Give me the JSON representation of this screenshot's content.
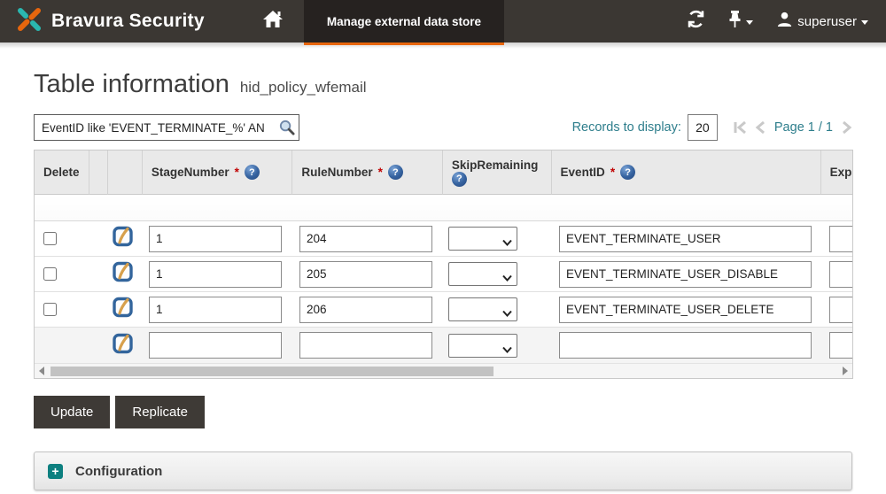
{
  "navbar": {
    "brand": "Bravura Security",
    "active_tab": "Manage external data store",
    "username": "superuser"
  },
  "page": {
    "title": "Table information",
    "subtitle": "hid_policy_wfemail"
  },
  "toolbar": {
    "search_value": "EventID like 'EVENT_TERMINATE_%' AN",
    "records_label": "Records to display:",
    "records_value": "20",
    "page_indicator": "Page 1 / 1"
  },
  "table": {
    "required_marker": "*",
    "help_marker": "?",
    "headers": {
      "delete": "Delete",
      "stage": "StageNumber",
      "rule": "RuleNumber",
      "skip": "SkipRemaining",
      "event": "EventID",
      "expr": "Expr"
    },
    "rows": [
      {
        "stage": "1",
        "rule": "204",
        "event": "EVENT_TERMINATE_USER"
      },
      {
        "stage": "1",
        "rule": "205",
        "event": "EVENT_TERMINATE_USER_DISABLE"
      },
      {
        "stage": "1",
        "rule": "206",
        "event": "EVENT_TERMINATE_USER_DELETE"
      },
      {
        "stage": "",
        "rule": "",
        "event": ""
      }
    ]
  },
  "actions": {
    "update": "Update",
    "replicate": "Replicate"
  },
  "sections": {
    "configuration": "Configuration"
  },
  "colors": {
    "accent_orange": "#e8660d",
    "teal_text": "#2e7e8c",
    "navbar_bg": "#3b3733",
    "active_tab_bg": "#262220",
    "button_bg": "#3e3a36",
    "help_blue": "#35629f",
    "config_icon_teal": "#0d8080",
    "header_bg": "#e9e9e9"
  }
}
